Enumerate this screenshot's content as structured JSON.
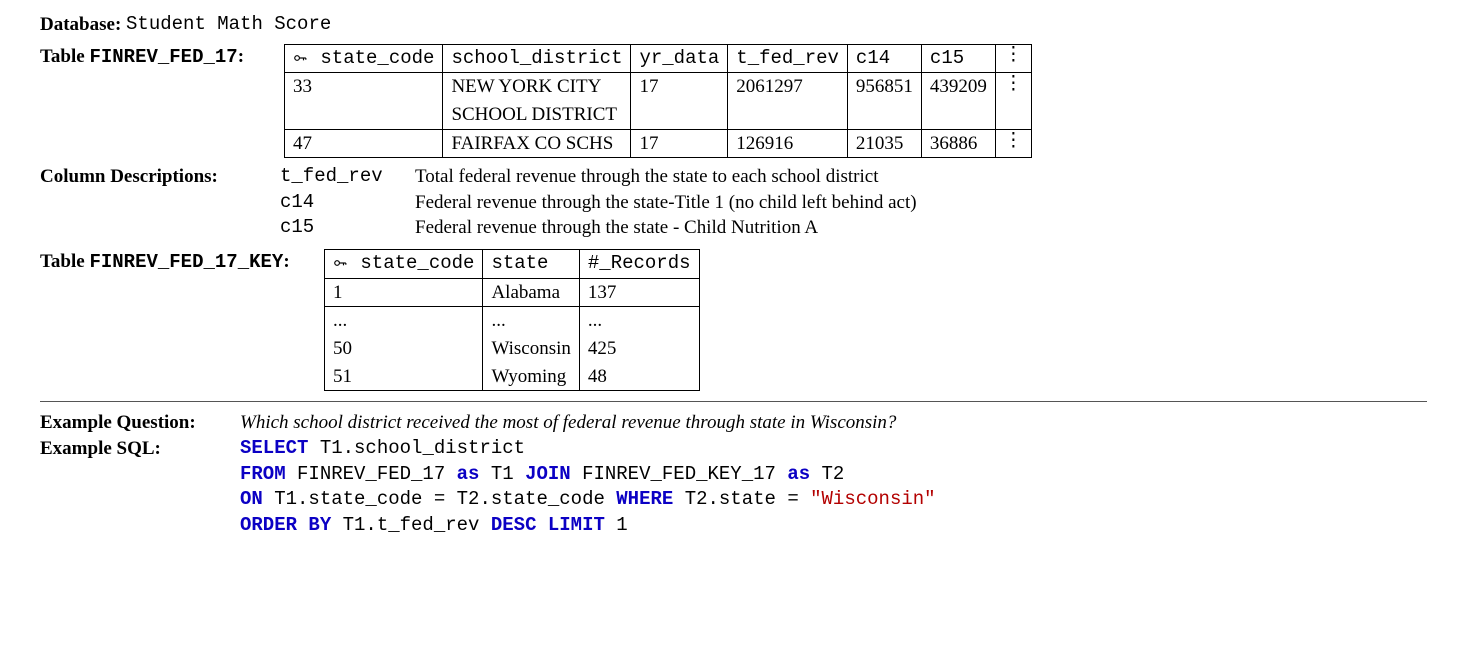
{
  "header": {
    "database_label": "Database:",
    "database_name": "Student Math Score"
  },
  "table1": {
    "label_prefix": "Table ",
    "name": "FINREV_FED_17",
    "label_suffix": ":",
    "headers": [
      "state_code",
      "school_district",
      "yr_data",
      "t_fed_rev",
      "c14",
      "c15"
    ],
    "rows": [
      {
        "state_code": "33",
        "school_district_l1": "NEW   YORK   CITY",
        "school_district_l2": "SCHOOL DISTRICT",
        "yr_data": "17",
        "t_fed_rev": "2061297",
        "c14": "956851",
        "c15": "439209"
      },
      {
        "state_code": "47",
        "school_district_l1": "FAIRFAX CO SCHS",
        "school_district_l2": "",
        "yr_data": "17",
        "t_fed_rev": "126916",
        "c14": "21035",
        "c15": "36886"
      }
    ]
  },
  "column_descriptions": {
    "label": "Column Descriptions:",
    "items": [
      {
        "col": "t_fed_rev",
        "desc": "Total federal revenue through the state to each school district"
      },
      {
        "col": "c14",
        "desc": "Federal revenue through the state-Title 1 (no child left behind act)"
      },
      {
        "col": "c15",
        "desc": "Federal revenue through the state - Child Nutrition A"
      }
    ]
  },
  "table2": {
    "label_prefix": "Table ",
    "name": "FINREV_FED_17_KEY",
    "label_suffix": ":",
    "headers": [
      "state_code",
      "state",
      "#_Records"
    ],
    "rows": [
      {
        "state_code": "1",
        "state": "Alabama",
        "records": "137"
      },
      {
        "state_code": "...",
        "state": "...",
        "records": "..."
      },
      {
        "state_code": "50",
        "state": "Wisconsin",
        "records": "425"
      },
      {
        "state_code": "51",
        "state": "Wyoming",
        "records": "48"
      }
    ]
  },
  "example": {
    "question_label": "Example Question:",
    "question": "Which school district received the most of federal revenue through state in Wisconsin?",
    "sql_label": "Example SQL:",
    "sql": {
      "kw_select": "SELECT",
      "select_expr": " T1.school_district",
      "kw_from": "FROM",
      "from_tbl1": " FINREV_FED_17 ",
      "kw_as1": "as",
      "alias1": " T1 ",
      "kw_join": "JOIN",
      "from_tbl2": " FINREV_FED_KEY_17 ",
      "kw_as2": "as",
      "alias2": " T2",
      "kw_on": "ON",
      "on_expr": " T1.state_code = T2.state_code ",
      "kw_where": "WHERE",
      "where_lhs": " T2.state = ",
      "where_str": "\"Wisconsin\"",
      "kw_orderby": "ORDER BY",
      "orderby_expr": " T1.t_fed_rev ",
      "kw_desc": "DESC",
      "sp": " ",
      "kw_limit": "LIMIT",
      "limit_n": " 1"
    }
  }
}
